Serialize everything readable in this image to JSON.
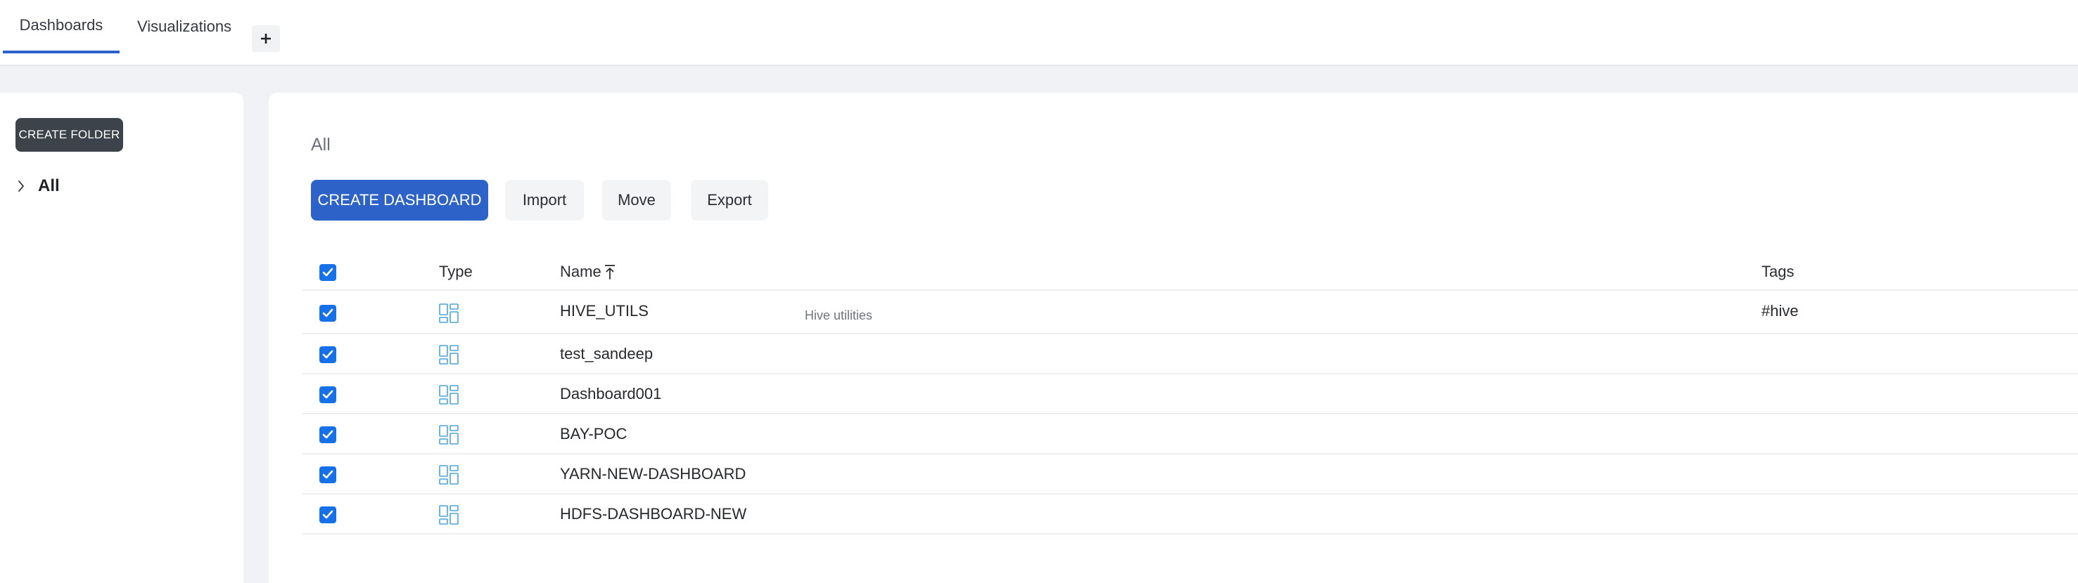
{
  "tabs": [
    {
      "label": "Dashboards",
      "active": true
    },
    {
      "label": "Visualizations",
      "active": false
    }
  ],
  "add_tab_icon": "plus-icon",
  "sidebar": {
    "create_folder_label": "CREATE FOLDER",
    "tree": [
      {
        "label": "All",
        "expanded": false,
        "icon": "chevron-right-icon"
      }
    ]
  },
  "main": {
    "breadcrumb": "All",
    "actions": {
      "create_dashboard": "CREATE DASHBOARD",
      "import": "Import",
      "move": "Move",
      "export": "Export"
    },
    "table": {
      "headers": {
        "type": "Type",
        "name": "Name",
        "tags": "Tags"
      },
      "sort": {
        "column": "name",
        "direction": "ascending",
        "icon": "sort-ascending-icon"
      },
      "select_all_checked": true,
      "rows": [
        {
          "name": "HIVE_UTILS",
          "description": "Hive utilities",
          "tags": "#hive",
          "checked": true,
          "type_icon": "dashboard-icon"
        },
        {
          "name": "test_sandeep",
          "description": "",
          "tags": "",
          "checked": true,
          "type_icon": "dashboard-icon"
        },
        {
          "name": "Dashboard001",
          "description": "",
          "tags": "",
          "checked": true,
          "type_icon": "dashboard-icon"
        },
        {
          "name": "BAY-POC",
          "description": "",
          "tags": "",
          "checked": true,
          "type_icon": "dashboard-icon"
        },
        {
          "name": "YARN-NEW-DASHBOARD",
          "description": "",
          "tags": "",
          "checked": true,
          "type_icon": "dashboard-icon"
        },
        {
          "name": "HDFS-DASHBOARD-NEW",
          "description": "",
          "tags": "",
          "checked": true,
          "type_icon": "dashboard-icon"
        }
      ]
    }
  },
  "colors": {
    "accent": "#2d63c8",
    "checkbox": "#1670e8",
    "dark_button": "#3d434b",
    "type_icon": "#4aa3d8",
    "background": "#f1f2f5"
  }
}
